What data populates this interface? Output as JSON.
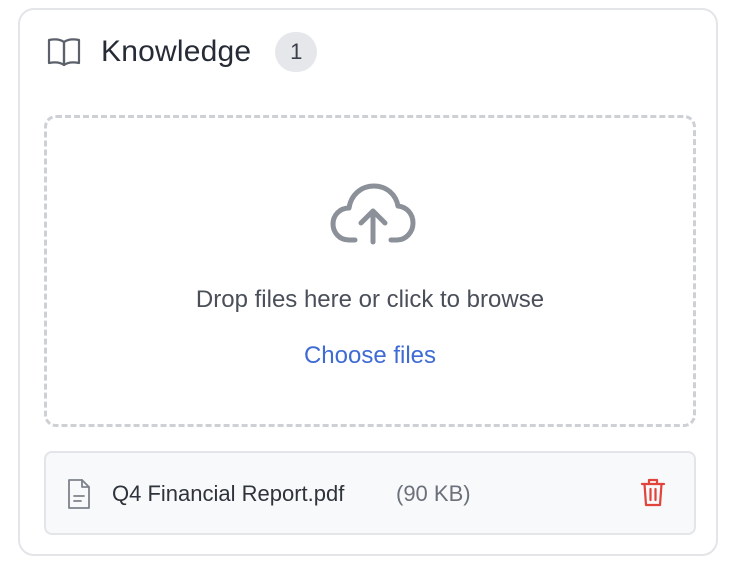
{
  "knowledge": {
    "title": "Knowledge",
    "count": "1",
    "icon": "book-open-icon"
  },
  "dropzone": {
    "icon": "cloud-upload-icon",
    "instruction": "Drop files here or click to browse",
    "choose_label": "Choose files"
  },
  "files": [
    {
      "icon": "file-text-icon",
      "name": "Q4 Financial Report.pdf",
      "size": "(90 KB)",
      "delete_icon": "trash-icon"
    }
  ],
  "colors": {
    "accent": "#3f6bd4",
    "danger": "#e0443a",
    "border": "#e3e5e8",
    "dashed_border": "#cdd0d5",
    "badge_bg": "#e6e7ea",
    "file_row_bg": "#f8f9fa"
  }
}
